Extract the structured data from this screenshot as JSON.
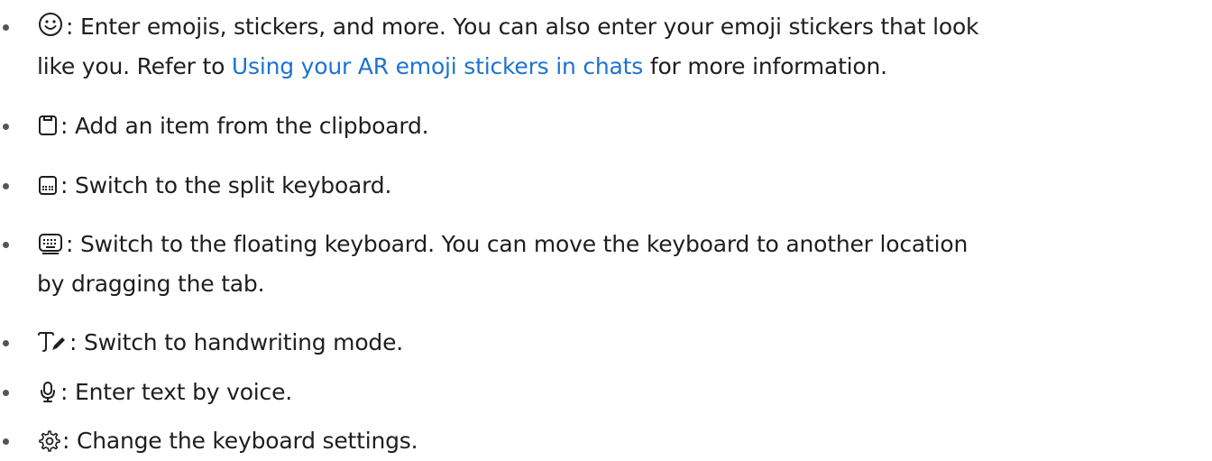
{
  "items": [
    {
      "icon": "emoji-icon",
      "text_before": ": Enter emojis, stickers, and more. You can also enter your emoji stickers that look",
      "line2_before": "like you. Refer to ",
      "link": "Using your AR emoji stickers in chats",
      "line2_after": " for more information."
    },
    {
      "icon": "clipboard-icon",
      "text": ": Add an item from the clipboard."
    },
    {
      "icon": "split-keyboard-icon",
      "text": ": Switch to the split keyboard."
    },
    {
      "icon": "floating-keyboard-icon",
      "text": ": Switch to the floating keyboard. You can move the keyboard to another location",
      "line2": "by dragging the tab."
    },
    {
      "icon": "handwriting-icon",
      "text": ": Switch to handwriting mode."
    },
    {
      "icon": "microphone-icon",
      "text": ": Enter text by voice."
    },
    {
      "icon": "settings-gear-icon",
      "text": ": Change the keyboard settings."
    }
  ],
  "colors": {
    "text": "#1e1e1e",
    "link": "#1b73d3",
    "bullet": "#555555"
  }
}
